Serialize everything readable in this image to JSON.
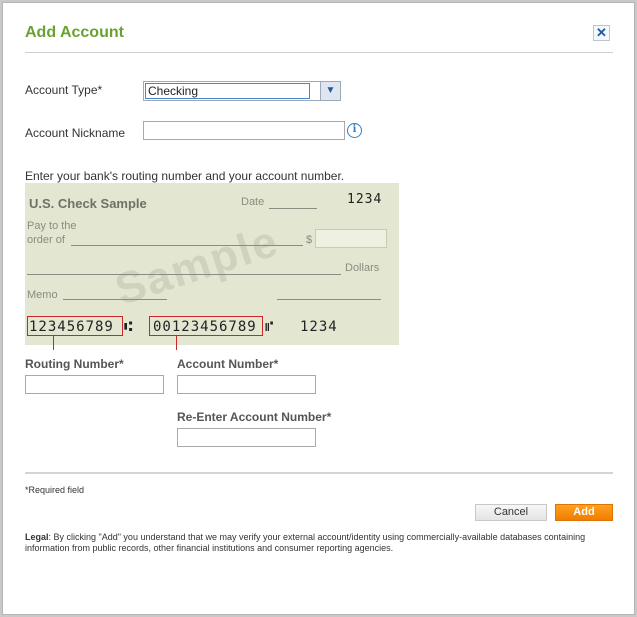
{
  "dialog": {
    "title": "Add Account",
    "close_glyph": "✕",
    "close_icon": "close-icon"
  },
  "form": {
    "account_type_label": "Account Type*",
    "account_type_value": "Checking",
    "dropdown_glyph": "▼",
    "nickname_label": "Account Nickname",
    "nickname_value": "",
    "info_glyph": "i",
    "instruction": "Enter your bank's routing number and your account number.",
    "routing_label": "Routing Number*",
    "account_label": "Account Number*",
    "reenter_label": "Re-Enter Account Number*",
    "routing_value": "",
    "account_value": "",
    "reenter_value": ""
  },
  "check": {
    "title": "U.S. Check Sample",
    "date_label": "Date",
    "check_number": "1234",
    "pay_to": "Pay to the",
    "order_of": "order of",
    "dollar_sign": "$",
    "dollars": "Dollars",
    "memo": "Memo",
    "watermark": "Sample",
    "routing_micr": "123456789",
    "routing_sep": "⑆",
    "account_micr": "00123456789",
    "account_sep": "⑈",
    "check_micr": "1234"
  },
  "footer": {
    "required_note": "*Required field",
    "cancel_label": "Cancel",
    "add_label": "Add",
    "legal_label": "Legal",
    "legal_text": ": By clicking \"Add\" you understand that we may verify your external account/identity using commercially-available databases containing information from public records, other financial institutions and consumer reporting agencies."
  },
  "colors": {
    "title_green": "#6aa232",
    "add_orange": "#f07d00",
    "link_blue": "#2f7fc6",
    "micr_red": "#c82828",
    "check_bg": "#e3e6d0"
  }
}
